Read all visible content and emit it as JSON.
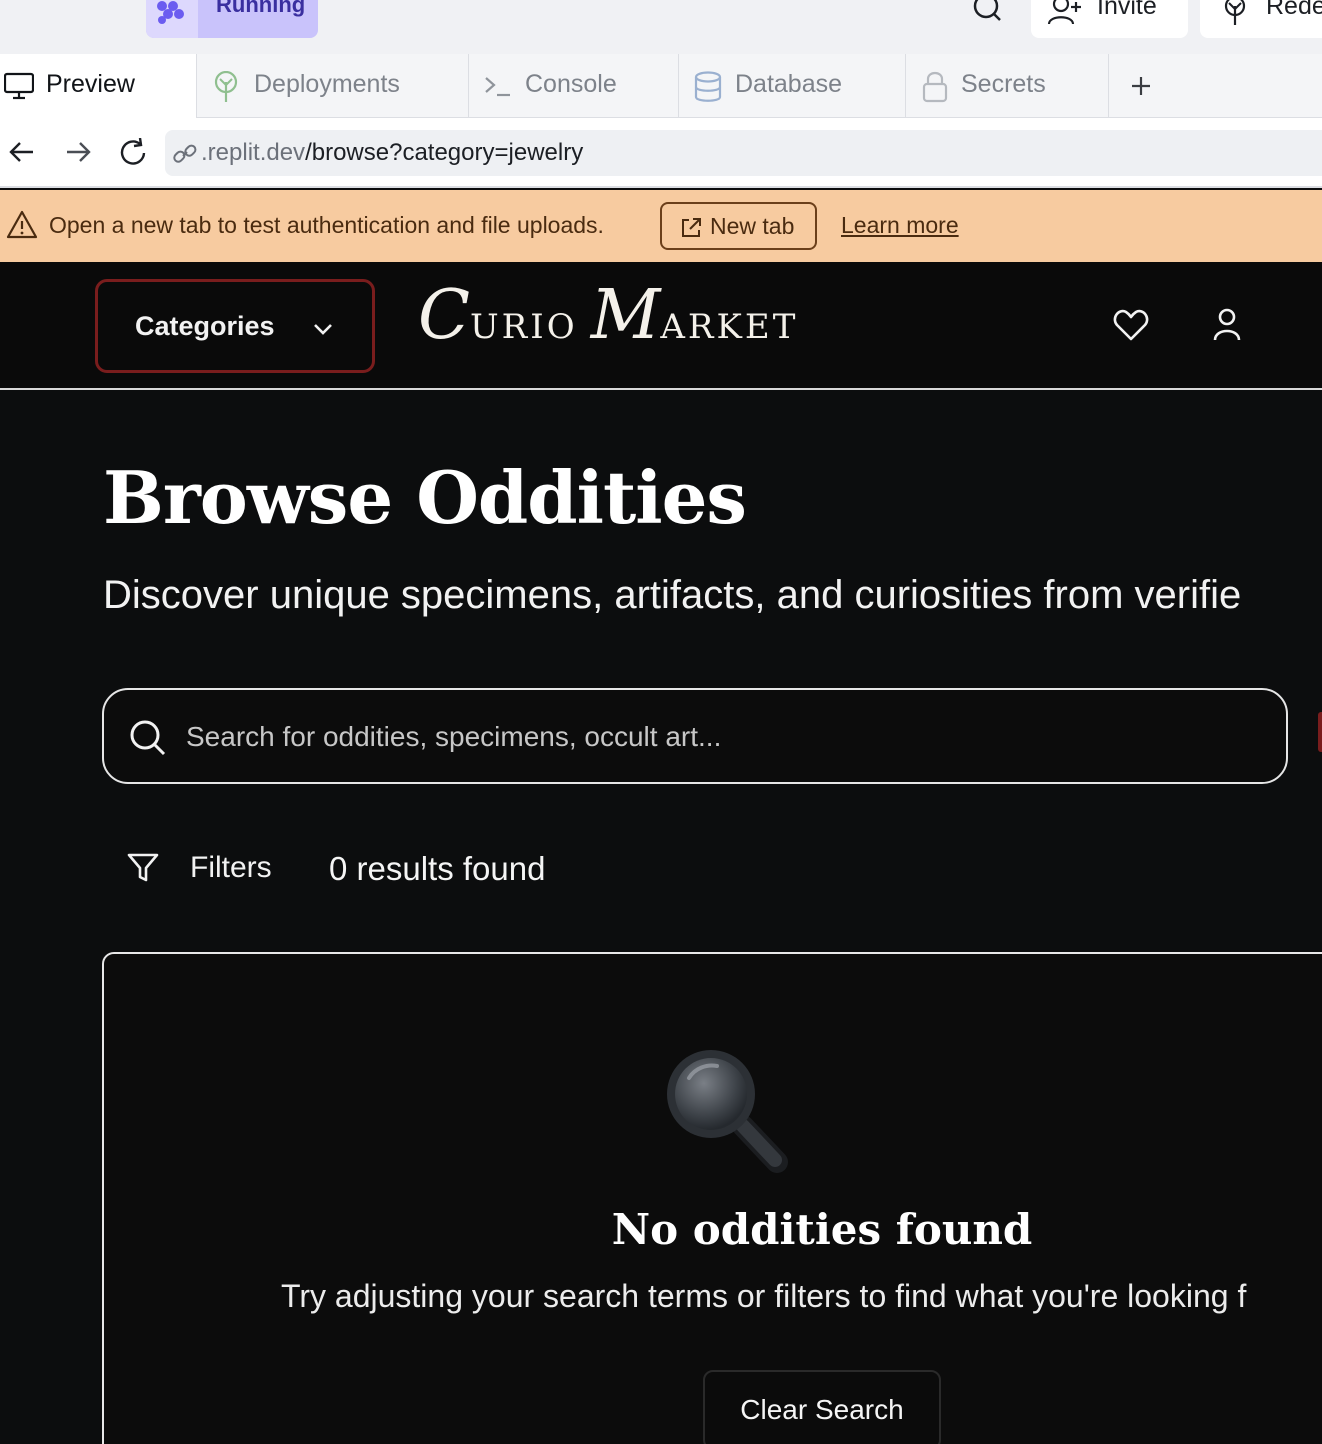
{
  "replit": {
    "status_label": "Running",
    "invite_label": "Invite",
    "redeploy_label": "Rede",
    "tabs": [
      {
        "label": "Preview",
        "icon": "monitor-icon"
      },
      {
        "label": "Deployments",
        "icon": "deploy-icon"
      },
      {
        "label": "Console",
        "icon": "terminal-icon"
      },
      {
        "label": "Database",
        "icon": "database-icon"
      },
      {
        "label": "Secrets",
        "icon": "lock-icon"
      }
    ],
    "url_muted": ".replit.dev",
    "url_path": "/browse?category=jewelry",
    "banner": {
      "message": "Open a new tab to test authentication and file uploads.",
      "new_tab_label": "New tab",
      "learn_more_label": "Learn more"
    }
  },
  "header": {
    "categories_label": "Categories",
    "logo": {
      "c": "C",
      "urio": "URIO",
      "m": "M",
      "arket": "ARKET"
    }
  },
  "main": {
    "title": "Browse Oddities",
    "subtitle": "Discover unique specimens, artifacts, and curiosities from verifie",
    "search_placeholder": "Search for oddities, specimens, occult art...",
    "filters_label": "Filters",
    "results_text": "0 results found",
    "empty": {
      "emoji": "🔍",
      "title": "No oddities found",
      "subtitle": "Try adjusting your search terms or filters to find what you're looking f",
      "clear_label": "Clear Search"
    }
  },
  "colors": {
    "banner_bg": "#f7cba0",
    "accent_red": "#7a1d1d",
    "running_pill": "#c9c3fb",
    "app_bg": "#0c0d0e"
  }
}
